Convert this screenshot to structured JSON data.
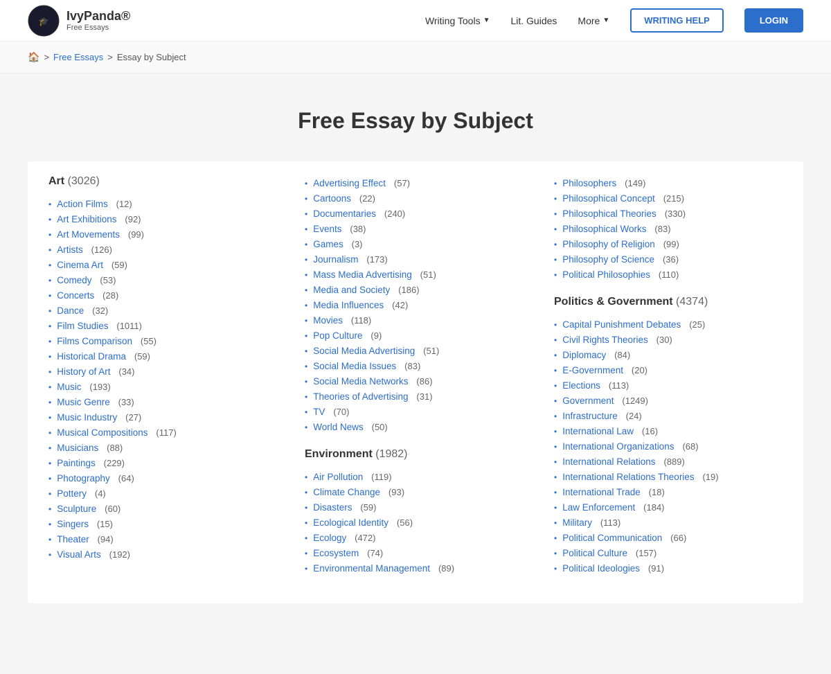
{
  "header": {
    "logo_name": "IvyPanda®",
    "logo_sub": "Free Essays",
    "nav": [
      {
        "label": "Writing Tools",
        "has_dropdown": true
      },
      {
        "label": "Lit. Guides",
        "has_dropdown": false
      },
      {
        "label": "More",
        "has_dropdown": true
      }
    ],
    "btn_writing": "WRITING HELP",
    "btn_login": "LOGIN"
  },
  "breadcrumb": {
    "home": "🏠",
    "links": [
      {
        "label": "Free Essays",
        "url": "#"
      },
      {
        "label": "Essay by Subject",
        "url": null
      }
    ]
  },
  "page_title": "Free Essay by Subject",
  "columns": [
    {
      "category": "Art",
      "count": "3026",
      "items": [
        {
          "label": "Action Films",
          "count": "12"
        },
        {
          "label": "Art Exhibitions",
          "count": "92"
        },
        {
          "label": "Art Movements",
          "count": "99"
        },
        {
          "label": "Artists",
          "count": "126"
        },
        {
          "label": "Cinema Art",
          "count": "59"
        },
        {
          "label": "Comedy",
          "count": "53"
        },
        {
          "label": "Concerts",
          "count": "28"
        },
        {
          "label": "Dance",
          "count": "32"
        },
        {
          "label": "Film Studies",
          "count": "1011"
        },
        {
          "label": "Films Comparison",
          "count": "55"
        },
        {
          "label": "Historical Drama",
          "count": "59"
        },
        {
          "label": "History of Art",
          "count": "34"
        },
        {
          "label": "Music",
          "count": "193"
        },
        {
          "label": "Music Genre",
          "count": "33"
        },
        {
          "label": "Music Industry",
          "count": "27"
        },
        {
          "label": "Musical Compositions",
          "count": "117"
        },
        {
          "label": "Musicians",
          "count": "88"
        },
        {
          "label": "Paintings",
          "count": "229"
        },
        {
          "label": "Photography",
          "count": "64"
        },
        {
          "label": "Pottery",
          "count": "4"
        },
        {
          "label": "Sculpture",
          "count": "60"
        },
        {
          "label": "Singers",
          "count": "15"
        },
        {
          "label": "Theater",
          "count": "94"
        },
        {
          "label": "Visual Arts",
          "count": "192"
        }
      ]
    },
    {
      "category": null,
      "count": null,
      "items_with_headers": [
        {
          "section_label": null,
          "items": [
            {
              "label": "Advertising Effect",
              "count": "57"
            },
            {
              "label": "Cartoons",
              "count": "22"
            },
            {
              "label": "Documentaries",
              "count": "240"
            },
            {
              "label": "Events",
              "count": "38"
            },
            {
              "label": "Games",
              "count": "3"
            },
            {
              "label": "Journalism",
              "count": "173"
            },
            {
              "label": "Mass Media Advertising",
              "count": "51"
            },
            {
              "label": "Media and Society",
              "count": "186"
            },
            {
              "label": "Media Influences",
              "count": "42"
            },
            {
              "label": "Movies",
              "count": "118"
            },
            {
              "label": "Pop Culture",
              "count": "9"
            },
            {
              "label": "Social Media Advertising",
              "count": "51"
            },
            {
              "label": "Social Media Issues",
              "count": "83"
            },
            {
              "label": "Social Media Networks",
              "count": "86"
            },
            {
              "label": "Theories of Advertising",
              "count": "31"
            },
            {
              "label": "TV",
              "count": "70"
            },
            {
              "label": "World News",
              "count": "50"
            }
          ]
        },
        {
          "section": "Environment",
          "section_count": "1982",
          "items": [
            {
              "label": "Air Pollution",
              "count": "119"
            },
            {
              "label": "Climate Change",
              "count": "93"
            },
            {
              "label": "Disasters",
              "count": "59"
            },
            {
              "label": "Ecological Identity",
              "count": "56"
            },
            {
              "label": "Ecology",
              "count": "472"
            },
            {
              "label": "Ecosystem",
              "count": "74"
            },
            {
              "label": "Environmental Management",
              "count": "89"
            }
          ]
        }
      ]
    },
    {
      "category": null,
      "count": null,
      "items_with_headers": [
        {
          "section_label": null,
          "items": [
            {
              "label": "Philosophers",
              "count": "149"
            },
            {
              "label": "Philosophical Concept",
              "count": "215"
            },
            {
              "label": "Philosophical Theories",
              "count": "330"
            },
            {
              "label": "Philosophical Works",
              "count": "83"
            },
            {
              "label": "Philosophy of Religion",
              "count": "99"
            },
            {
              "label": "Philosophy of Science",
              "count": "36"
            },
            {
              "label": "Political Philosophies",
              "count": "110"
            }
          ]
        },
        {
          "section": "Politics & Government",
          "section_count": "4374",
          "items": [
            {
              "label": "Capital Punishment Debates",
              "count": "25"
            },
            {
              "label": "Civil Rights Theories",
              "count": "30"
            },
            {
              "label": "Diplomacy",
              "count": "84"
            },
            {
              "label": "E-Government",
              "count": "20"
            },
            {
              "label": "Elections",
              "count": "113"
            },
            {
              "label": "Government",
              "count": "1249"
            },
            {
              "label": "Infrastructure",
              "count": "24"
            },
            {
              "label": "International Law",
              "count": "16"
            },
            {
              "label": "International Organizations",
              "count": "68"
            },
            {
              "label": "International Relations",
              "count": "889"
            },
            {
              "label": "International Relations Theories",
              "count": "19"
            },
            {
              "label": "International Trade",
              "count": "18"
            },
            {
              "label": "Law Enforcement",
              "count": "184"
            },
            {
              "label": "Military",
              "count": "113"
            },
            {
              "label": "Political Communication",
              "count": "66"
            },
            {
              "label": "Political Culture",
              "count": "157"
            },
            {
              "label": "Political Ideologies",
              "count": "91"
            }
          ]
        }
      ]
    }
  ]
}
